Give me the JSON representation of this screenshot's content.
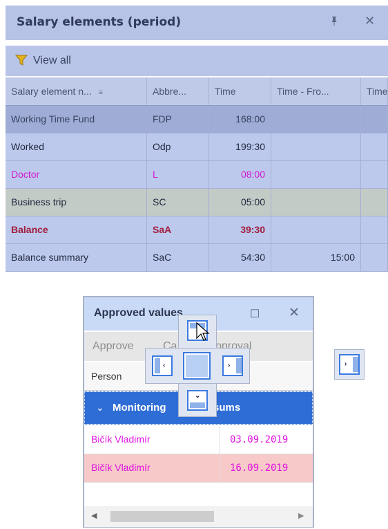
{
  "salary_panel": {
    "title": "Salary elements (period)",
    "pin_icon": "pin-icon",
    "close_icon": "close-icon",
    "toolbar": {
      "view_all_label": "View all",
      "view_all_icon": "filter-icon"
    },
    "columns": [
      "Salary element n...",
      "Abbre...",
      "Time",
      "Time - Fro...",
      "Time"
    ],
    "rows": [
      {
        "name": "Working Time Fund",
        "abbr": "FDP",
        "time": "168:00",
        "time_from": "",
        "bg": "#9eacd6",
        "color": "#3a4260",
        "bold": false
      },
      {
        "name": "Worked",
        "abbr": "Odp",
        "time": "199:30",
        "time_from": "",
        "bg": "#bcc8ec",
        "color": "#222a40",
        "bold": false
      },
      {
        "name": "Doctor",
        "abbr": "L",
        "time": "08:00",
        "time_from": "",
        "bg": "#bcc8ec",
        "color": "#d417d4",
        "bold": false
      },
      {
        "name": "Business trip",
        "abbr": "SC",
        "time": "05:00",
        "time_from": "",
        "bg": "#c3cbc6",
        "color": "#222a40",
        "bold": false
      },
      {
        "name": "Balance",
        "abbr": "SaA",
        "time": "39:30",
        "time_from": "",
        "bg": "#bcc8ec",
        "color": "#a01c3c",
        "bold": true
      },
      {
        "name": "Balance summary",
        "abbr": "SaC",
        "time": "54:30",
        "time_from": "15:00",
        "bg": "#bcc8ec",
        "color": "#222a40",
        "bold": false
      }
    ]
  },
  "approved_panel": {
    "title": "Approved values",
    "maximize_icon": "maximize-icon",
    "close_icon": "close-icon",
    "toolbar": {
      "approve_label": "Approve",
      "cancel_label": "Ca",
      "approval_label": "pproval"
    },
    "column_header": "Person",
    "group_label": "Monitoring",
    "group_label_tail": "y sums",
    "rows": [
      {
        "person": "Bičík Vladimír",
        "date": "03.09.2019",
        "bg": "#ffffff"
      },
      {
        "person": "Bičík Vladimír",
        "date": "16.09.2019",
        "bg": "#f7c9c9"
      }
    ]
  },
  "dock_guides": {
    "icons": [
      "dock-top-icon",
      "dock-left-icon",
      "dock-center-icon",
      "dock-right-icon",
      "dock-bottom-icon",
      "dock-outer-right-icon"
    ]
  },
  "colors": {
    "title_bar": "#b6c2e6",
    "group_bar": "#2f6dd6",
    "highlight_text": "#d417d4",
    "balance_text": "#a01c3c"
  }
}
